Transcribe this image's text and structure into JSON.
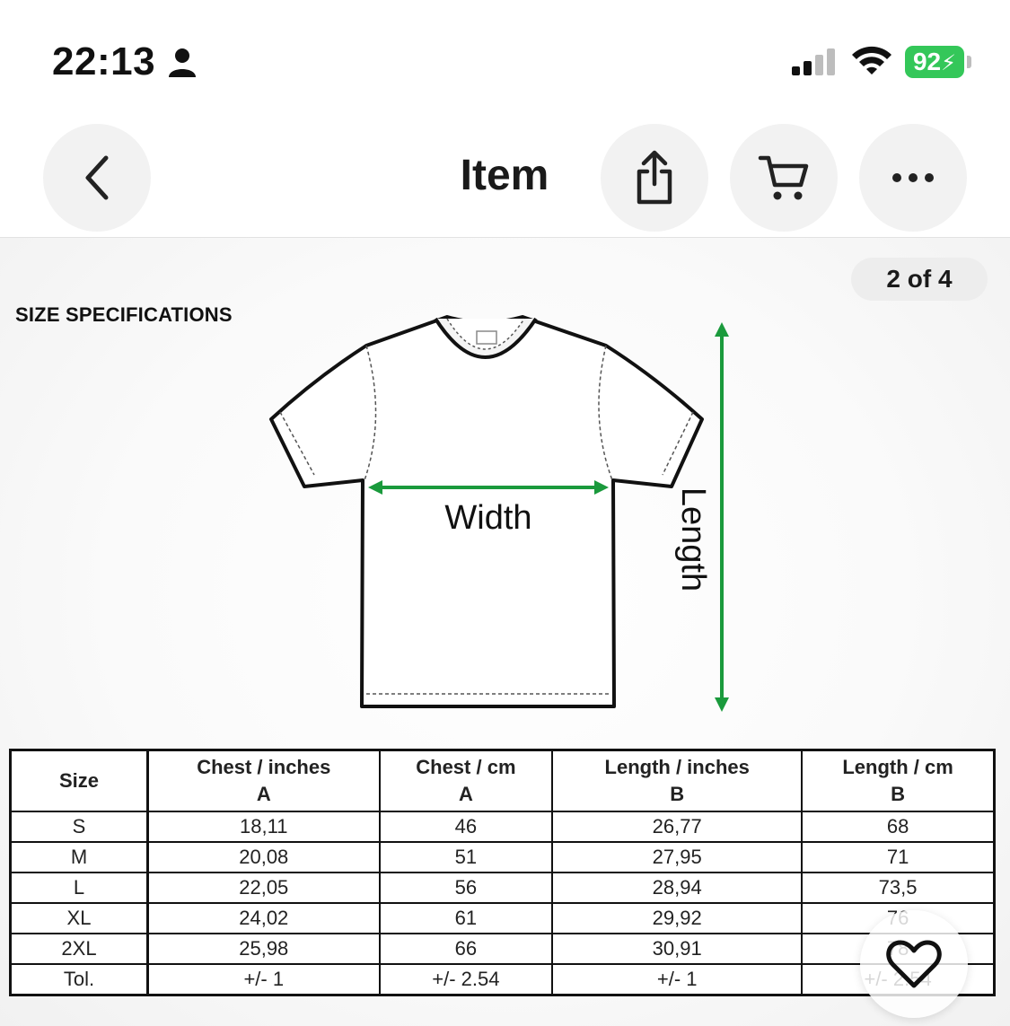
{
  "status_bar": {
    "time": "22:13",
    "battery": "92"
  },
  "nav": {
    "title": "Item",
    "icons": {
      "back": "chevron-left-icon",
      "share": "share-icon",
      "cart": "cart-icon",
      "more": "more-icon"
    }
  },
  "gallery": {
    "counter": "2 of 4"
  },
  "image": {
    "heading": "SIZE SPECIFICATIONS",
    "width_label": "Width",
    "length_label": "Length",
    "accent_color": "#1a9a3c"
  },
  "table": {
    "headers": [
      {
        "line1": "Size",
        "line2": ""
      },
      {
        "line1": "Chest / inches",
        "line2": "A"
      },
      {
        "line1": "Chest / cm",
        "line2": "A"
      },
      {
        "line1": "Length / inches",
        "line2": "B"
      },
      {
        "line1": "Length / cm",
        "line2": "B"
      }
    ],
    "rows": [
      [
        "S",
        "18,11",
        "46",
        "26,77",
        "68"
      ],
      [
        "M",
        "20,08",
        "51",
        "27,95",
        "71"
      ],
      [
        "L",
        "22,05",
        "56",
        "28,94",
        "73,5"
      ],
      [
        "XL",
        "24,02",
        "61",
        "29,92",
        "76"
      ],
      [
        "2XL",
        "25,98",
        "66",
        "30,91",
        "78"
      ],
      [
        "Tol.",
        "+/- 1",
        "+/- 2.54",
        "+/- 1",
        "+/- 2.54"
      ]
    ]
  },
  "favorite": {
    "icon": "heart-icon"
  }
}
